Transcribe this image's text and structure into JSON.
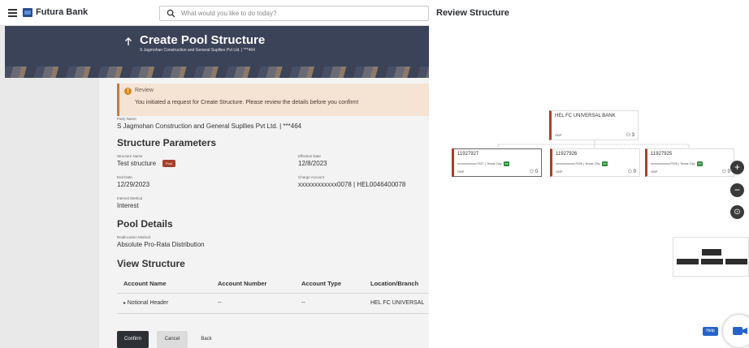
{
  "app": {
    "brand": "Futura Bank",
    "search_placeholder": "What would you like to do today?"
  },
  "page": {
    "title": "Create Pool Structure",
    "subtitle": "S Jagmohan Construction and General Supllies Pvt Ltd. | ***464"
  },
  "review": {
    "heading": "Review",
    "message": "You initiated a request for Create Structure. Please review the details before you confirm!"
  },
  "party": {
    "label": "Party Name",
    "value": "S Jagmohan Construction and General Supllies Pvt Ltd. | ***464"
  },
  "structure": {
    "heading": "Structure Parameters",
    "name_label": "Structure Name",
    "name_value": "Test structure",
    "badge": "Pool",
    "eff_label": "Effective Date",
    "eff_value": "12/8/2023",
    "end_label": "End Date",
    "end_value": "12/29/2023",
    "charge_label": "Charge Account",
    "charge_value": "xxxxxxxxxxxx0078 | HEL0046400078",
    "interest_label": "Interest Method",
    "interest_value": "Interest"
  },
  "pool": {
    "heading": "Pool Details",
    "realloc_label": "Reallocation Method",
    "realloc_value": "Absolute Pro-Rata Distribution"
  },
  "view": {
    "heading": "View Structure",
    "columns": [
      "Account Name",
      "Account Number",
      "Account Type",
      "Location/Branch"
    ],
    "row": {
      "name": "Notional Header",
      "number": "--",
      "type": "--",
      "branch": "HEL FC UNIVERSAL"
    }
  },
  "buttons": {
    "confirm": "Confirm",
    "cancel": "Cancel",
    "back": "Back"
  },
  "panel": {
    "title": "Review Structure",
    "root": {
      "name": "HEL FC UNIVERSAL BANK",
      "currency": "GBP",
      "count": "3"
    },
    "children": [
      {
        "acc": "11927927",
        "detail": "xxxxxxxxxxxx7927 | Texas City",
        "badge": "Int",
        "currency": "GBP",
        "count": "0"
      },
      {
        "acc": "11927926",
        "detail": "xxxxxxxxxxxx7926 | Texas City",
        "badge": "Int",
        "currency": "GBP",
        "count": "0"
      },
      {
        "acc": "11927925",
        "detail": "xxxxxxxxxxxx7925 | Texas City",
        "badge": "Int",
        "currency": "GBP",
        "count": "0"
      }
    ],
    "zoom_in": "+",
    "zoom_out": "−",
    "reset": "⊙",
    "help": "Help"
  },
  "colors": {
    "accent": "#a5402a",
    "banner": "#3b4358",
    "review_bg": "#f5e3d3",
    "help_blue": "#2563c9"
  }
}
